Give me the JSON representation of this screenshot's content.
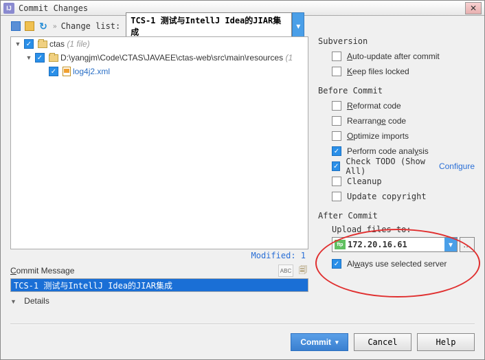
{
  "window": {
    "title": "Commit Changes"
  },
  "toolbar": {
    "change_list_label": "Change list:",
    "change_list_value": "TCS-1 测试与IntellJ Idea的JIAR集成"
  },
  "tree": {
    "root_name": "ctas",
    "root_hint": "(1 file)",
    "path_name": "D:\\yangjm\\Code\\CTAS\\JAVAEE\\ctas-web\\src\\main\\resources",
    "path_hint": "(1",
    "file_name": "log4j2.xml"
  },
  "modified_label": "Modified: 1",
  "commit_message_label": "Commit Message",
  "commit_message_value": "TCS-1 测试与IntellJ Idea的JIAR集成",
  "details_label": "Details",
  "subversion": {
    "title": "Subversion",
    "auto_update": "uto-update after commit",
    "keep_locked": "eep files locked"
  },
  "before": {
    "title": "Before Commit",
    "reformat": "eformat code",
    "rearrange": "Rearrang",
    "rearrange2": " code",
    "optimize": "ptimize imports",
    "analysis": "Perform code anal",
    "analysis2": "sis",
    "todo": "Check TODO (Show All)",
    "configure": "Configure",
    "cleanup": "Cleanup",
    "copyright": "Update copyright"
  },
  "after": {
    "title": "After Commit",
    "upload_label": "Upload files to:",
    "upload_value": "172.20.16.61",
    "always_use": "Al",
    "always_use2": "ays use selected server"
  },
  "buttons": {
    "commit": "Commit",
    "cancel": "Cancel",
    "help": "Help"
  }
}
